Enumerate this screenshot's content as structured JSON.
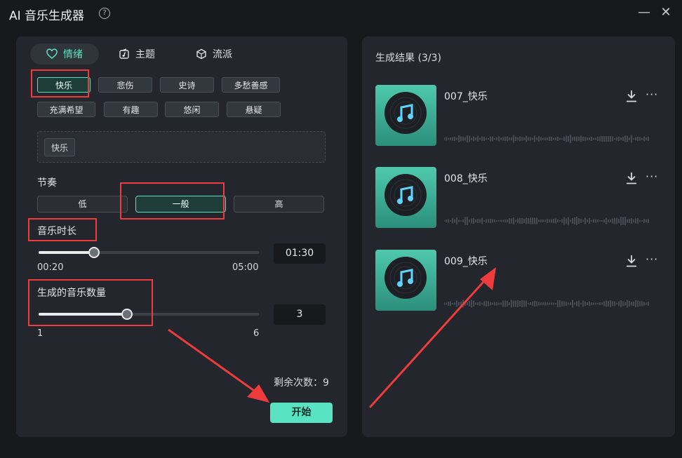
{
  "window": {
    "title": "AI 音乐生成器",
    "help": "?",
    "minimize": "—",
    "close": "✕"
  },
  "tabs": [
    {
      "label": "情绪",
      "icon": "heart-mood-icon"
    },
    {
      "label": "主题",
      "icon": "theme-note-icon"
    },
    {
      "label": "流派",
      "icon": "cube-genre-icon"
    }
  ],
  "moods": [
    "快乐",
    "悲伤",
    "史诗",
    "多愁善感",
    "充满希望",
    "有趣",
    "悠闲",
    "悬疑"
  ],
  "selected_tags": [
    "快乐"
  ],
  "tempo": {
    "label": "节奏",
    "options": [
      "低",
      "一般",
      "高"
    ],
    "selected": "一般"
  },
  "duration": {
    "label": "音乐时长",
    "min": "00:20",
    "max": "05:00",
    "value": "01:30",
    "fraction": 0.25
  },
  "count": {
    "label": "生成的音乐数量",
    "min": "1",
    "max": "6",
    "value": "3",
    "fraction": 0.4
  },
  "remaining": "剩余次数：9",
  "start": "开始",
  "results": {
    "header": "生成结果 (3/3)",
    "items": [
      {
        "title": "007_快乐"
      },
      {
        "title": "008_快乐"
      },
      {
        "title": "009_快乐"
      }
    ]
  },
  "colors": {
    "accent": "#59e3c3",
    "highlight": "#ee3b3b",
    "panel": "#23262c",
    "background": "#17191d"
  }
}
